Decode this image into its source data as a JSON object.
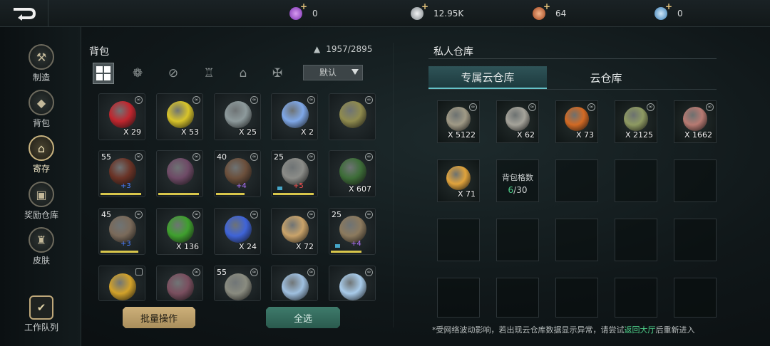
{
  "topbar": {
    "currencies": [
      {
        "icon": "purple-gem-icon",
        "value": "0",
        "color": "#a552d6"
      },
      {
        "icon": "silver-coin-icon",
        "value": "12.95K",
        "color": "#c9cfd3"
      },
      {
        "icon": "bronze-coin-icon",
        "value": "64",
        "color": "#d9774a"
      },
      {
        "icon": "blue-crystal-icon",
        "value": "0",
        "color": "#6fa8d8"
      }
    ]
  },
  "sidebar": {
    "items": [
      {
        "label": "制造",
        "icon": "hammer-icon",
        "glyph": "⚒"
      },
      {
        "label": "背包",
        "icon": "bag-icon",
        "glyph": "◆"
      },
      {
        "label": "寄存",
        "icon": "storage-icon",
        "glyph": "⌂"
      },
      {
        "label": "奖励仓库",
        "icon": "chest-icon",
        "glyph": "▣"
      },
      {
        "label": "皮肤",
        "icon": "armor-icon",
        "glyph": "♜"
      }
    ],
    "work_queue": "工作队列"
  },
  "bag": {
    "title": "背包",
    "capacity": "1957/2895",
    "sort": "默认",
    "filters": [
      "grid-icon",
      "materials-icon",
      "ammo-icon",
      "consumable-icon",
      "building-icon",
      "equipment-icon"
    ],
    "slots": [
      {
        "name": "red-potion",
        "color": "#c0262e",
        "count": "X 29"
      },
      {
        "name": "yellow-potion",
        "color": "#d8c42a",
        "count": "X 53"
      },
      {
        "name": "metal-key",
        "color": "#8d9a9c",
        "count": "X 25"
      },
      {
        "name": "blue-spirit",
        "color": "#7fa8e8",
        "count": "X 2"
      },
      {
        "name": "green-compass",
        "color": "#8f8b4e",
        "count": ""
      },
      {
        "name": "fire-staff",
        "color": "#6a3326",
        "level": "55",
        "plus": "+3",
        "plus_color": "blue",
        "bar": 0.92
      },
      {
        "name": "leather-pouch",
        "color": "#6e4a66",
        "bar": 0.92
      },
      {
        "name": "longbow",
        "color": "#6b4f3b",
        "level": "40",
        "plus": "+4",
        "plus_color": "purple",
        "bar": 0.65
      },
      {
        "name": "battle-axe",
        "color": "#8b8c88",
        "level": "25",
        "plus": "+5",
        "plus_color": "red",
        "gem": true,
        "bar": 0.92
      },
      {
        "name": "green-tome",
        "color": "#3d6d38",
        "count": "X 607"
      },
      {
        "name": "polearm",
        "color": "#7a6a5a",
        "level": "45",
        "plus": "+3",
        "plus_color": "blue",
        "bar": 0.85
      },
      {
        "name": "green-ore",
        "color": "#3fa02e",
        "count": "X 136"
      },
      {
        "name": "blue-crystal",
        "color": "#3f64d8",
        "count": "X 24"
      },
      {
        "name": "scroll",
        "color": "#c9a36a",
        "count": "X 72"
      },
      {
        "name": "spear",
        "color": "#8c7a5e",
        "level": "25",
        "plus": "+4",
        "plus_color": "purple",
        "gem": true,
        "bar": 0.7
      },
      {
        "name": "gold-medallion",
        "color": "#d2a22a",
        "locked": true
      },
      {
        "name": "brown-pouch",
        "color": "#7a4f5f"
      },
      {
        "name": "twin-swords",
        "color": "#8a8c80",
        "level": "55"
      },
      {
        "name": "ice-axe",
        "color": "#9fc0e0"
      },
      {
        "name": "ice-spear",
        "color": "#a8cbea"
      }
    ],
    "batch_button": "批量操作",
    "select_all_button": "全选"
  },
  "warehouse": {
    "title": "私人仓库",
    "tabs": [
      "专属云仓库",
      "云仓库"
    ],
    "items": [
      {
        "name": "iron-ring",
        "color": "#a09a86",
        "count": "X 5122"
      },
      {
        "name": "horseshoe",
        "color": "#a5a39a",
        "count": "X 62"
      },
      {
        "name": "fire-ore",
        "color": "#d26a24",
        "count": "X 73"
      },
      {
        "name": "gems-pile",
        "color": "#8e9a62",
        "count": "X 2125"
      },
      {
        "name": "copper-ore",
        "color": "#b77a72",
        "count": "X 1662"
      },
      {
        "name": "gold-nuggets",
        "color": "#e0a33c",
        "count": "X 71"
      }
    ],
    "capacity_label": "背包格数",
    "capacity_used": "6",
    "capacity_total": "/30",
    "notice_pre": "*受网络波动影响，若出现云仓库数据显示异常，请尝试",
    "notice_link": "返回大厅",
    "notice_post": "后重新进入"
  }
}
